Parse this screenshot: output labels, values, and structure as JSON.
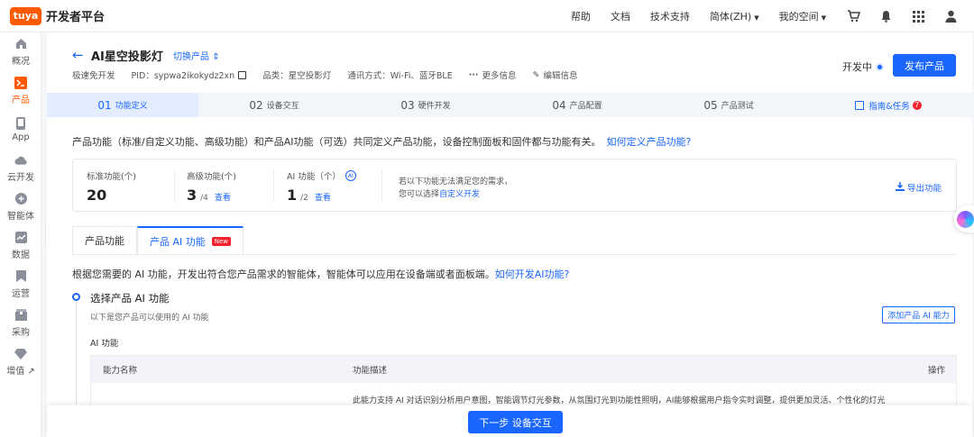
{
  "brand": {
    "logo": "tuya",
    "name": "开发者平台",
    "accent": "#1a66ff",
    "brand_color": "#ff5a00"
  },
  "topnav": {
    "links": [
      "帮助",
      "文档",
      "技术支持"
    ],
    "language": "简体(ZH)",
    "space": "我的空间",
    "icons": [
      "cart-icon",
      "bell-icon",
      "apps-grid-icon",
      "user-icon"
    ]
  },
  "sidebar": {
    "items": [
      {
        "label": "概况",
        "icon": "home-icon"
      },
      {
        "label": "产品",
        "icon": "terminal-icon"
      },
      {
        "label": "App",
        "icon": "phone-icon"
      },
      {
        "label": "云开发",
        "icon": "cloud-icon"
      },
      {
        "label": "智能体",
        "icon": "plus-circle-icon"
      },
      {
        "label": "数据",
        "icon": "chart-icon"
      },
      {
        "label": "运营",
        "icon": "bookmark-icon"
      },
      {
        "label": "采购",
        "icon": "box-icon"
      },
      {
        "label": "增值",
        "icon": "diamond-icon"
      }
    ]
  },
  "product": {
    "title": "AI星空投影灯",
    "switch_label": "切换产品",
    "dev_mode": "极速免开发",
    "pid": "PID：sypwa2ikokydz2xn",
    "category": "品类：星空投影灯",
    "comm": "通讯方式：Wi-Fi、蓝牙BLE",
    "more": "更多信息",
    "edit": "编辑信息",
    "status": "开发中",
    "publish": "发布产品"
  },
  "steps": [
    {
      "num": "01",
      "label": "功能定义"
    },
    {
      "num": "02",
      "label": "设备交互"
    },
    {
      "num": "03",
      "label": "硬件开发"
    },
    {
      "num": "04",
      "label": "产品配置"
    },
    {
      "num": "05",
      "label": "产品测试"
    }
  ],
  "guide": {
    "label": "指南&任务",
    "count": "7"
  },
  "intro": {
    "text": "产品功能（标准/自定义功能、高级功能）和产品AI功能（可选）共同定义产品功能，设备控制面板和固件都与功能有关。",
    "link": "如何定义产品功能?"
  },
  "stats": {
    "standard": {
      "label": "标准功能(个)",
      "value": "20"
    },
    "advanced": {
      "label": "高级功能(个)",
      "value": "3",
      "total": "/4",
      "view": "查看"
    },
    "ai": {
      "label": "AI 功能（个）",
      "badge": "AI",
      "value": "1",
      "total": "/2",
      "view": "查看"
    },
    "note_line1": "若以下功能无法满足您的需求，",
    "note_line2_prefix": "您可以选择",
    "note_line2_link": "自定义开发",
    "export": "导出功能"
  },
  "tabs": [
    {
      "label": "产品功能"
    },
    {
      "label": "产品 AI 功能",
      "badge": "New"
    }
  ],
  "ai_section": {
    "desc": "根据您需要的 AI 功能，开发出符合您产品需求的智能体，智能体可以应用在设备端或者面板端。",
    "desc_link": "如何开发AI功能?",
    "title": "选择产品 AI 功能",
    "subtitle": "以下是您产品可以使用的 AI 功能",
    "add_button": "添加产品 AI 能力",
    "list_label": "AI 功能",
    "columns": [
      "能力名称",
      "功能描述",
      "操作"
    ],
    "rows": [
      {
        "name": "",
        "desc": "此能力支持 AI 对话识别分析用户意图，智能调节灯光参数，从氛围灯光到功能性照明，AI能够根据用户指令实时调整，提供更加灵活、个性化的灯光"
      }
    ]
  },
  "footer": {
    "next": "下一步 设备交互"
  }
}
